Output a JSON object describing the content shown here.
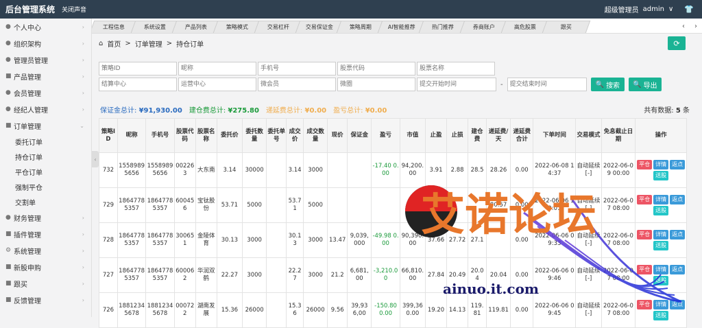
{
  "topbar": {
    "title": "后台管理系统",
    "mute": "关闭声音",
    "role": "超级管理员",
    "user": "admin",
    "chevron": "∨",
    "shirt_icon": "shirt-icon"
  },
  "sidebar": {
    "items": [
      {
        "label": "个人中心",
        "icon": "user-icon"
      },
      {
        "label": "组织架构",
        "icon": "group-icon"
      },
      {
        "label": "管理员管理",
        "icon": "user-icon"
      },
      {
        "label": "产品管理",
        "icon": "doc-icon"
      },
      {
        "label": "会员管理",
        "icon": "user-icon"
      },
      {
        "label": "经纪人管理",
        "icon": "group-icon"
      },
      {
        "label": "订单管理",
        "icon": "doc-icon"
      }
    ],
    "sub_items": [
      "委托订单",
      "持仓订单",
      "平仓订单",
      "强制平仓",
      "交割单"
    ],
    "items2": [
      {
        "label": "财务管理",
        "icon": "money-icon"
      },
      {
        "label": "插件管理",
        "icon": "plugin-icon"
      },
      {
        "label": "系统管理",
        "icon": "gear-icon"
      },
      {
        "label": "新股申购",
        "icon": "doc-icon"
      },
      {
        "label": "跟买",
        "icon": "doc-icon"
      },
      {
        "label": "反馈管理",
        "icon": "doc-icon"
      }
    ]
  },
  "tabs": [
    "工程信息",
    "系统设置",
    "产品列表",
    "策略模式",
    "交易杠杆",
    "交易保证金",
    "策略周期",
    "AI智能推荐",
    "热门推荐",
    "券商账户",
    "高危股票",
    "跟买"
  ],
  "breadcrumb": {
    "home": "首页",
    "sep": ">",
    "level1": "订单管理",
    "level2": "持仓订单"
  },
  "filters": {
    "row1": [
      "策略ID",
      "昵称",
      "手机号",
      "股票代码",
      "股票名称"
    ],
    "row2": [
      "结算中心",
      "运营中心",
      "微会员",
      "微圈",
      "提交开始时间"
    ],
    "dash": "-",
    "end_time": "提交结束时间",
    "search": "搜索",
    "export": "导出"
  },
  "summary": {
    "margin_label": "保证金总计:",
    "margin_value": "¥91,930.00",
    "fee_label": "建仓费总计:",
    "fee_value": "¥275.80",
    "defer_label": "递延费总计:",
    "defer_value": "¥0.00",
    "pl_label": "盈亏总计:",
    "pl_value": "¥0.00",
    "total_label": "共有数据:",
    "total_value": "5",
    "total_unit": "条"
  },
  "table": {
    "headers": [
      "策略ID",
      "昵称",
      "手机号",
      "股票代码",
      "股票名称",
      "委托价",
      "委托数量",
      "委托单号",
      "成交价",
      "成交数量",
      "现价",
      "保证金",
      "盈亏",
      "市值",
      "止盈",
      "止损",
      "建仓费",
      "递延费/天",
      "递延费合计",
      "下单时间",
      "交易模式",
      "免息截止日期",
      "操作"
    ],
    "rows": [
      [
        "732",
        "15589895656",
        "15589895656",
        "002263",
        "大东南",
        "3.14",
        "30000",
        "",
        "3.14",
        "3000",
        "",
        "",
        "-17.40 0.00",
        "94,200.00",
        "3.91",
        "2.88",
        "28.5",
        "28.26",
        "0.00",
        "2022-06-08 14:37",
        "自动延续 [-]",
        "2022-06-09 00:00"
      ],
      [
        "729",
        "18647785357",
        "18647785357",
        "600456",
        "宝钛股份",
        "53.71",
        "5000",
        "",
        "53.71",
        "5000",
        "",
        "",
        "",
        "",
        "67.1",
        "",
        "",
        "80.57",
        "0.00",
        "2022-06-06 10:01",
        "自动延续 [-]",
        "2022-06-07 08:00"
      ],
      [
        "728",
        "18647785357",
        "18647785357",
        "300651",
        "金陵体育",
        "30.13",
        "3000",
        "",
        "30.13",
        "3000",
        "13.47",
        "9,039,000",
        "-49.98 0.00",
        "90,390.00",
        "37.66",
        "27.72",
        "27.1",
        "",
        "0.00",
        "2022-06-06 09:33",
        "自动延续 [-]",
        "2022-06-07 08:00"
      ],
      [
        "727",
        "18647785357",
        "18647785357",
        "600062",
        "华润双鹤",
        "22.27",
        "3000",
        "",
        "22.27",
        "3000",
        "21.2",
        "6,681,00",
        "-3,210.00",
        "66,810.00",
        "27.84",
        "20.49",
        "20.04",
        "20.04",
        "0.00",
        "2022-06-06 09:46",
        "自动延续 [-]",
        "2022-06-07 08:00"
      ],
      [
        "726",
        "18812345678",
        "18812345678",
        "000722",
        "湖南发展",
        "15.36",
        "26000",
        "",
        "15.36",
        "26000",
        "9.56",
        "39,936,00",
        "-150.80 0.00",
        "399,360.00",
        "19.20",
        "14.13",
        "119.81",
        "119.81",
        "0.00",
        "2022-06-06 09:45",
        "自动延续 [-]",
        "2022-06-07 08:00"
      ]
    ],
    "ops": [
      "平仓",
      "详情",
      "返点",
      "送股"
    ]
  },
  "watermark": {
    "text": "艾诺论坛",
    "url": "ainuo.it.com"
  },
  "colors": {
    "accent": "#1ab394",
    "topbar": "#2f4050",
    "red": "#ed5565",
    "blue": "#3a9ad9"
  }
}
